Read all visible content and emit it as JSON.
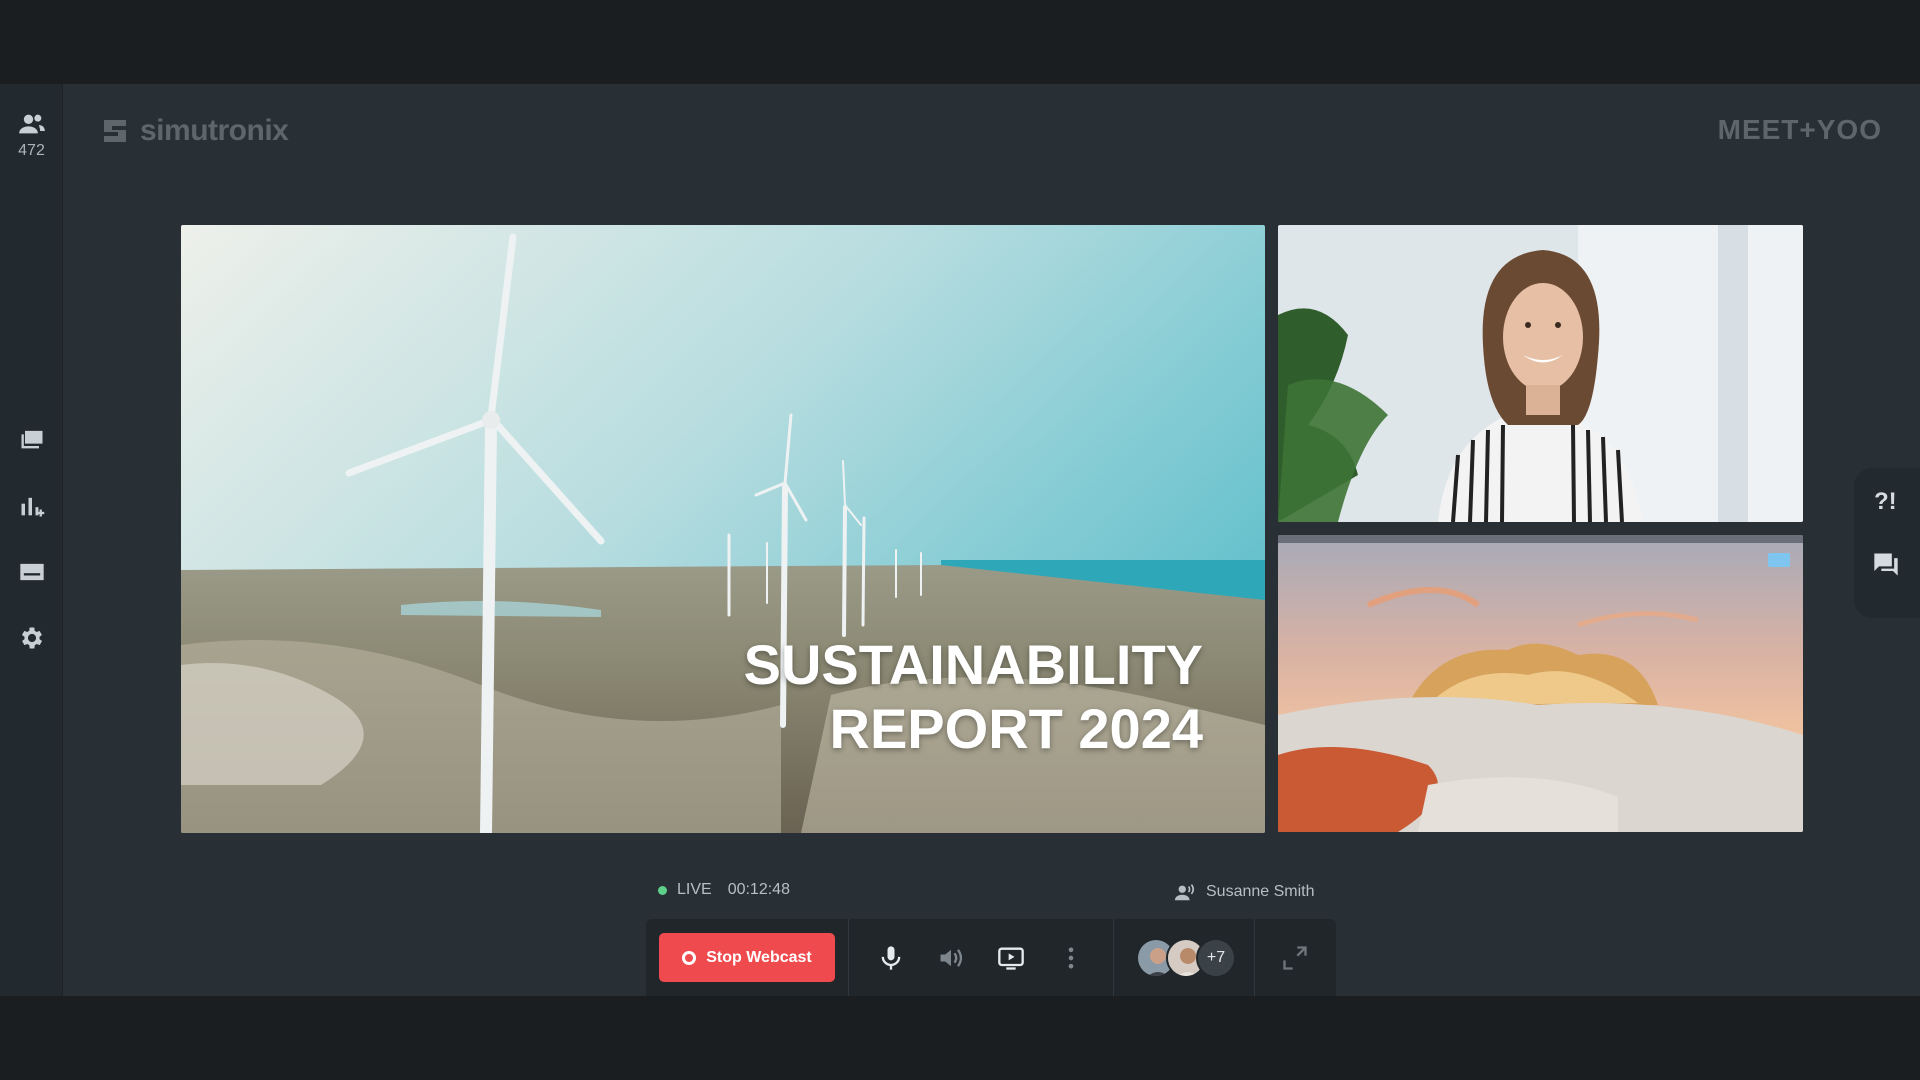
{
  "sidebar": {
    "participants_count": "472"
  },
  "brand": {
    "name": "simutronix"
  },
  "partner": {
    "name": "MEET+YOO"
  },
  "slide": {
    "title_line1": "SUSTAINABILITY",
    "title_line2": "REPORT 2024"
  },
  "status": {
    "live_label": "LIVE",
    "elapsed": "00:12:48"
  },
  "speaker": {
    "name": "Susanne Smith"
  },
  "toolbar": {
    "stop_label": "Stop Webcast",
    "more_participants": "+7"
  },
  "rail": {
    "qa_label": "?!"
  },
  "colors": {
    "accent": "#ef4b4f",
    "live": "#5fd08a",
    "background": "#283036"
  }
}
